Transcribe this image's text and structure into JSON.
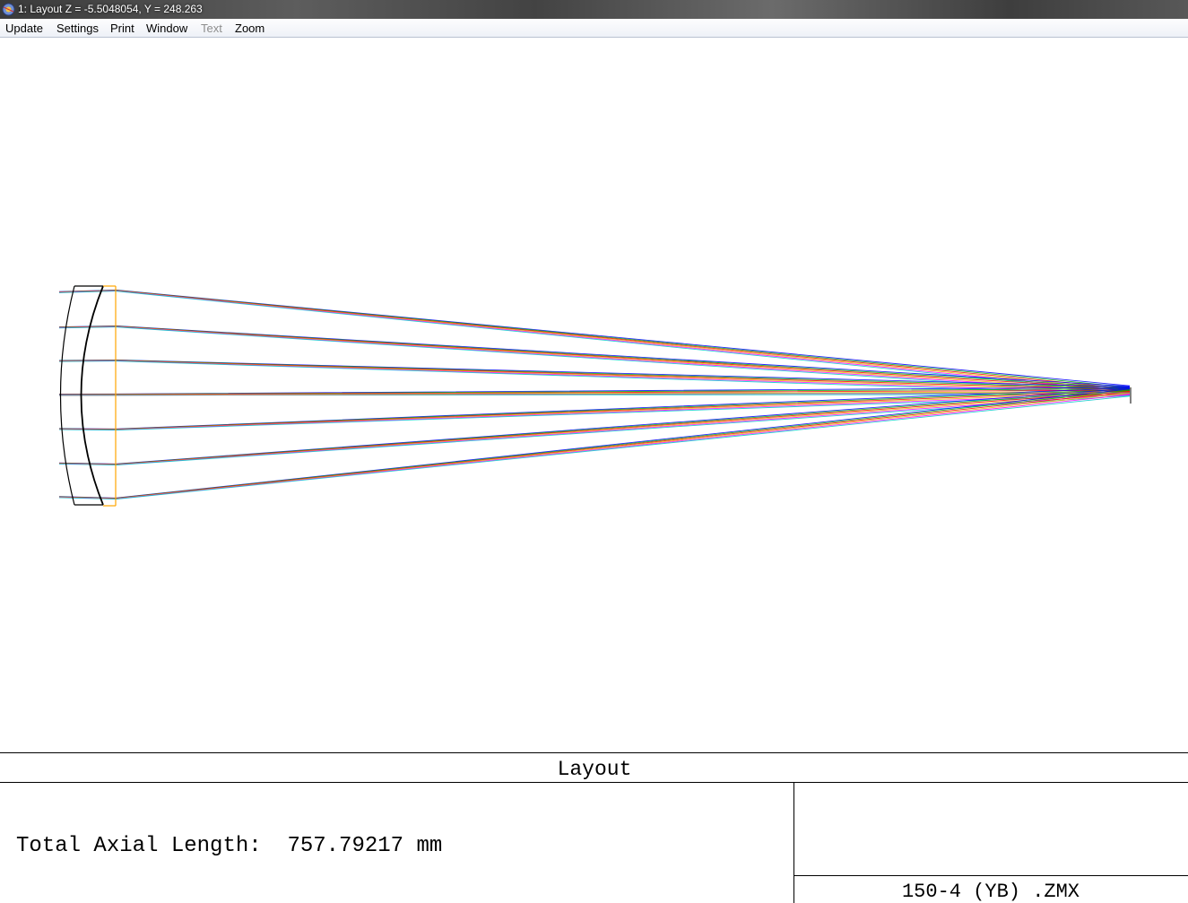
{
  "window": {
    "title": "1: Layout Z = -5.5048054, Y = 248.263",
    "app_icon": "zemax-app-icon"
  },
  "menu": {
    "items": [
      {
        "label": "Update",
        "enabled": true
      },
      {
        "label": "Settings",
        "enabled": true
      },
      {
        "label": "Print",
        "enabled": true
      },
      {
        "label": "Window",
        "enabled": true
      },
      {
        "label": "Text",
        "enabled": false
      },
      {
        "label": "Zoom",
        "enabled": true
      }
    ]
  },
  "plot": {
    "title": "Layout",
    "info_line": "Total Axial Length:  757.79217 mm",
    "file_name": "150-4 (YB) .ZMX",
    "ray_colors": [
      "#0000ff",
      "#00aa00",
      "#ff0000",
      "#e0c000",
      "#ff00ff",
      "#00c8c8"
    ],
    "lens_outline_color": "#000000",
    "image_surface_color": "#ffa500"
  }
}
